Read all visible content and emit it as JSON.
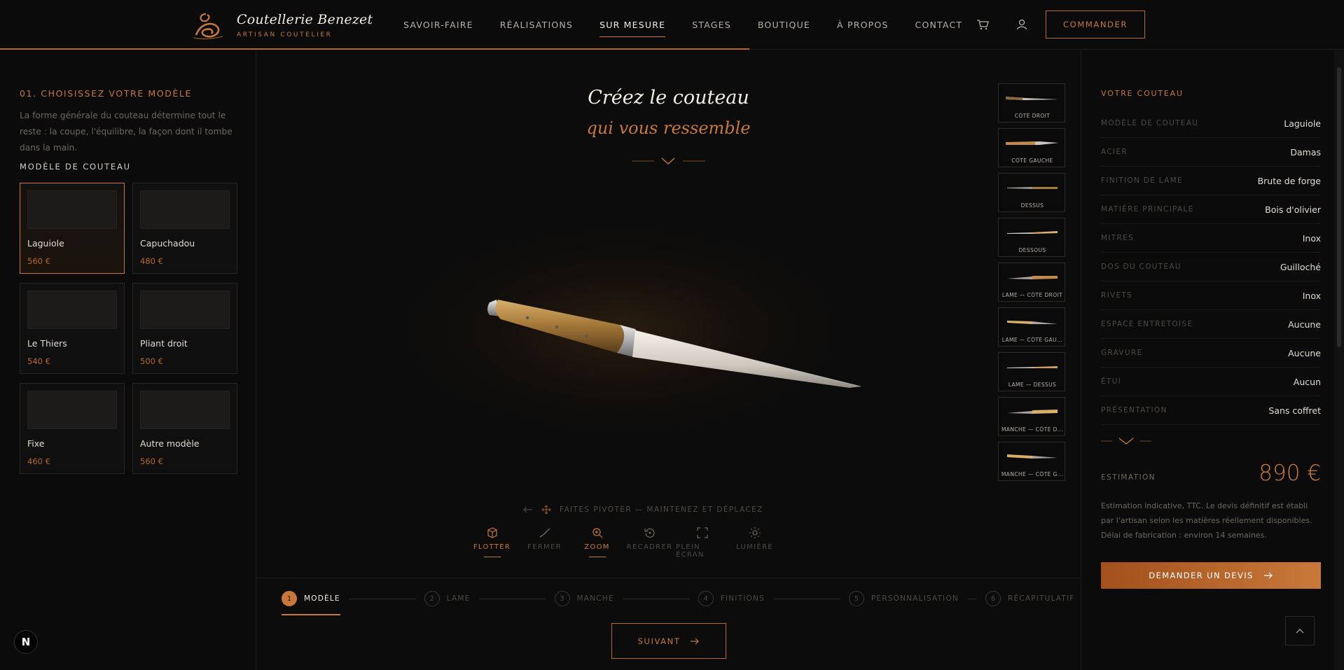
{
  "brand": {
    "title": "Coutellerie Benezet",
    "subtitle": "ARTISAN COUTELIER"
  },
  "nav": {
    "items": [
      {
        "label": "SAVOIR-FAIRE"
      },
      {
        "label": "RÉALISATIONS"
      },
      {
        "label": "SUR MESURE"
      },
      {
        "label": "STAGES"
      },
      {
        "label": "BOUTIQUE"
      },
      {
        "label": "À PROPOS"
      },
      {
        "label": "CONTACT"
      }
    ],
    "active": "SUR MESURE",
    "cta": "COMMANDER"
  },
  "left": {
    "step_title": "01.  CHOISISSEZ VOTRE MODÈLE",
    "description": "La forme générale du couteau détermine tout le reste : la coupe, l'équilibre, la façon dont il tombe dans la main.",
    "model_heading": "MODÈLE DE COUTEAU",
    "models": [
      {
        "name": "Laguiole",
        "price": "560 €"
      },
      {
        "name": "Capuchadou",
        "price": "480 €"
      },
      {
        "name": "Le Thiers",
        "price": "540 €"
      },
      {
        "name": "Pliant droit",
        "price": "500 €"
      },
      {
        "name": "Fixe",
        "price": "460 €"
      },
      {
        "name": "Autre modèle",
        "price": "560 €"
      }
    ],
    "selected": "Laguiole"
  },
  "center": {
    "hero_line1": "Créez le couteau",
    "hero_line2": "qui vous ressemble",
    "thumbnails": [
      {
        "label": "CÔTÉ DROIT"
      },
      {
        "label": "CÔTÉ GAUCHE"
      },
      {
        "label": "DESSUS"
      },
      {
        "label": "DESSOUS"
      },
      {
        "label": "LAME — CÔTÉ DROIT"
      },
      {
        "label": "LAME — CÔTÉ GAU..."
      },
      {
        "label": "LAME — DESSUS"
      },
      {
        "label": "MANCHE — CÔTÉ D..."
      },
      {
        "label": "MANCHE — CÔTÉ G..."
      }
    ],
    "hint": "FAITES PIVOTER — MAINTENEZ ET DÉPLACEZ",
    "tools": [
      {
        "label": "FLOTTER",
        "icon": "cube-icon",
        "active": true
      },
      {
        "label": "FERMER",
        "icon": "knife-close-icon",
        "active": false
      },
      {
        "label": "ZOOM",
        "icon": "zoom-icon",
        "active": true
      },
      {
        "label": "RECADRER",
        "icon": "reset-icon",
        "active": false
      },
      {
        "label": "PLEIN ÉCRAN",
        "icon": "fullscreen-icon",
        "active": false
      },
      {
        "label": "LUMIÈRE",
        "icon": "light-icon",
        "active": false
      }
    ],
    "steps": [
      {
        "num": "1",
        "label": "MODÈLE"
      },
      {
        "num": "2",
        "label": "LAME"
      },
      {
        "num": "3",
        "label": "MANCHE"
      },
      {
        "num": "4",
        "label": "FINITIONS"
      },
      {
        "num": "5",
        "label": "PERSONNALISATION"
      },
      {
        "num": "6",
        "label": "RÉCAPITULATIF"
      }
    ],
    "next_label": "SUIVANT"
  },
  "summary": {
    "title": "VOTRE COUTEAU",
    "rows": [
      {
        "key": "MODÈLE DE COUTEAU",
        "value": "Laguiole"
      },
      {
        "key": "ACIER",
        "value": "Damas"
      },
      {
        "key": "FINITION DE LAME",
        "value": "Brute de forge"
      },
      {
        "key": "MATIÈRE PRINCIPALE",
        "value": "Bois d'olivier"
      },
      {
        "key": "MITRES",
        "value": "Inox"
      },
      {
        "key": "DOS DU COUTEAU",
        "value": "Guilloché"
      },
      {
        "key": "RIVETS",
        "value": "Inox"
      },
      {
        "key": "ESPACE ENTRETOISE",
        "value": "Aucune"
      },
      {
        "key": "GRAVURE",
        "value": "Aucune"
      },
      {
        "key": "ÉTUI",
        "value": "Aucun"
      },
      {
        "key": "PRÉSENTATION",
        "value": "Sans coffret"
      }
    ],
    "estimate_label": "ESTIMATION",
    "estimate_value": "890 €",
    "note": "Estimation indicative, TTC. Le devis définitif est établi par l'artisan selon les matières réellement disponibles. Délai de fabrication : environ 14 semaines.",
    "cta": "DEMANDER UN DEVIS"
  },
  "badge": "N",
  "colors": {
    "accent": "#c8793a",
    "bg": "#0c0c0c",
    "text": "#e8e2d8"
  }
}
